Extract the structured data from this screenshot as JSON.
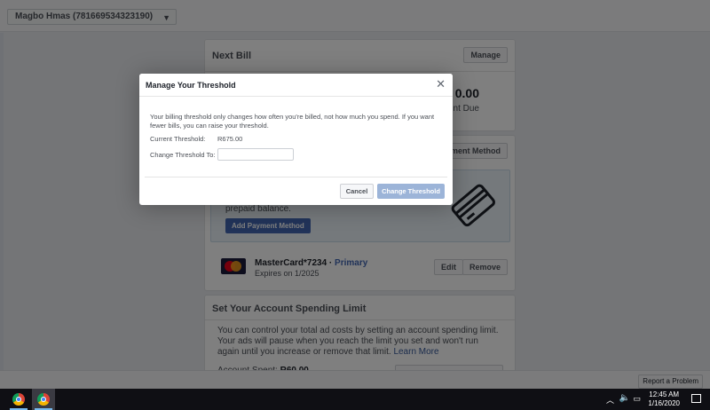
{
  "topbar": {
    "account_selector": "Magbo Hmas (781669534323190)",
    "caret": "▼"
  },
  "next_bill": {
    "title": "Next Bill",
    "manage_label": "Manage",
    "amount": "0.00",
    "amount_label": "unt Due"
  },
  "payment": {
    "add_payment_method_label": "Payment Method",
    "prepaid_text": "prepaid balance.",
    "add_payment_primary_label": "Add Payment Method",
    "card_name": "MasterCard*7234 ·",
    "card_primary": "Primary",
    "card_expires": "Expires on 1/2025",
    "edit_label": "Edit",
    "remove_label": "Remove"
  },
  "spending_limit": {
    "title": "Set Your Account Spending Limit",
    "text": "You can control your total ad costs by setting an account spending limit. Your ads will pause when you reach the limit you set and won't run again until you increase or remove that limit.",
    "learn_more": "Learn More",
    "spent_label": "Account Spent:",
    "spent_value": "R60.00"
  },
  "footer": {
    "report_label": "Report a Problem"
  },
  "modal": {
    "title": "Manage Your Threshold",
    "close": "✕",
    "description": "Your billing threshold only changes how often you're billed, not how much you spend. If you want fewer bills, you can raise your threshold.",
    "current_label": "Current Threshold:",
    "current_value": "R675.00",
    "change_label": "Change Threshold To:",
    "change_value": "",
    "cancel_label": "Cancel",
    "change_button_label": "Change Threshold"
  },
  "taskbar": {
    "apps": [
      {
        "icon": "chrome-icon",
        "active": false
      },
      {
        "icon": "chrome-icon",
        "active": true
      }
    ],
    "time": "12:45 AM",
    "date": "1/16/2020"
  },
  "colors": {
    "accent": "#4267b2",
    "disabled_accent": "#9cb4d8",
    "page_bg": "#e9ebee"
  }
}
